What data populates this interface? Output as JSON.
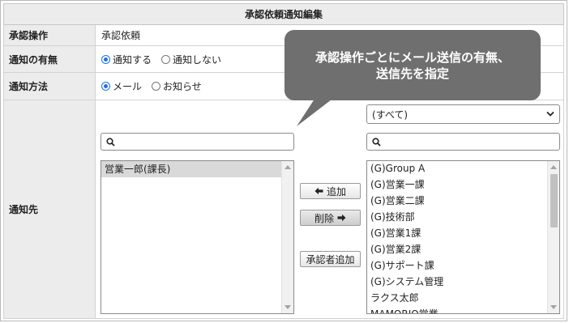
{
  "header": {
    "title": "承認依頼通知編集"
  },
  "rows": {
    "operation": {
      "label": "承認操作",
      "value": "承認依頼"
    },
    "notify": {
      "label": "通知の有無",
      "options": [
        "通知する",
        "通知しない"
      ],
      "selected": "通知する"
    },
    "method": {
      "label": "通知方法",
      "options": [
        "メール",
        "お知らせ"
      ],
      "selected": "メール"
    },
    "recipients": {
      "label": "通知先"
    }
  },
  "left_list": {
    "items": [
      "営業一郎(課長)"
    ],
    "selected": "営業一郎(課長)"
  },
  "buttons": {
    "add": "追加",
    "remove": "削除",
    "add_approver": "承認者追加"
  },
  "right_panel": {
    "filter_value": "(すべて)",
    "items": [
      "(G)Group A",
      "(G)営業一課",
      "(G)営業二課",
      "(G)技術部",
      "(G)営業1課",
      "(G)営業2課",
      "(G)サポート課",
      "(G)システム管理",
      "ラクス太郎",
      "MAMORIO営業"
    ]
  },
  "callout": {
    "line1": "承認操作ごとにメール送信の有無、",
    "line2": "送信先を指定"
  },
  "icons": [
    "search-icon",
    "arrow-left-icon",
    "arrow-right-icon",
    "chevron-down-icon"
  ]
}
